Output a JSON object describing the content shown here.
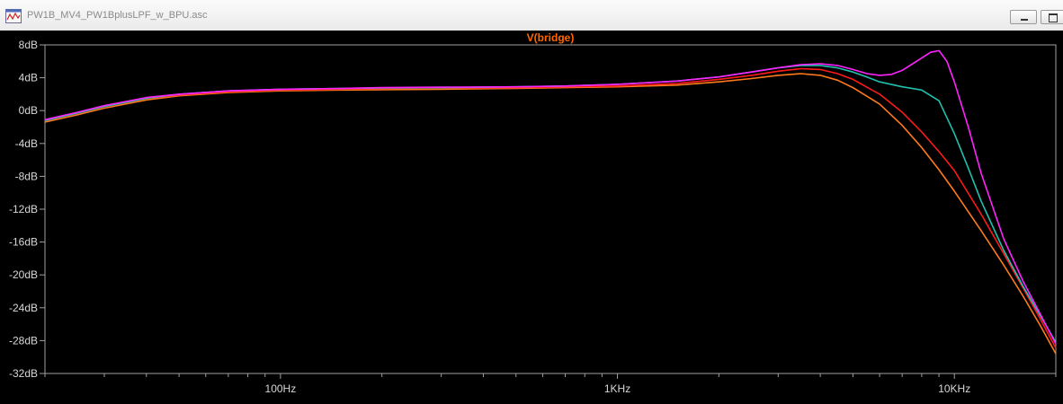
{
  "window": {
    "title": "PW1B_MV4_PW1BplusLPF_w_BPU.asc",
    "app_icon": "waveform-window-icon",
    "minimize_icon": "minimize-icon",
    "maximize_icon": "maximize-icon"
  },
  "colors": {
    "plot_background": "#000000",
    "axis": "#a0a0a0",
    "label_text": "#d8d8d8",
    "trace_label": "#ff6600"
  },
  "chart_data": {
    "type": "line",
    "title": "V(bridge)",
    "xlabel": "",
    "ylabel": "",
    "x_scale": "log",
    "xlim": [
      20,
      20000
    ],
    "ylim": [
      -32,
      8
    ],
    "grid": false,
    "x_ticks": [
      {
        "value": 100,
        "label": "100Hz"
      },
      {
        "value": 1000,
        "label": "1KHz"
      },
      {
        "value": 10000,
        "label": "10KHz"
      }
    ],
    "y_ticks": [
      {
        "value": 8,
        "label": "8dB"
      },
      {
        "value": 4,
        "label": "4dB"
      },
      {
        "value": 0,
        "label": "0dB"
      },
      {
        "value": -4,
        "label": "-4dB"
      },
      {
        "value": -8,
        "label": "-8dB"
      },
      {
        "value": -12,
        "label": "-12dB"
      },
      {
        "value": -16,
        "label": "-16dB"
      },
      {
        "value": -20,
        "label": "-20dB"
      },
      {
        "value": -24,
        "label": "-24dB"
      },
      {
        "value": -28,
        "label": "-28dB"
      },
      {
        "value": -32,
        "label": "-32dB"
      }
    ],
    "series": [
      {
        "color": "#ff7a1a",
        "points": [
          [
            20,
            -1.4
          ],
          [
            25,
            -0.5
          ],
          [
            30,
            0.3
          ],
          [
            40,
            1.3
          ],
          [
            50,
            1.8
          ],
          [
            70,
            2.2
          ],
          [
            100,
            2.4
          ],
          [
            150,
            2.5
          ],
          [
            200,
            2.55
          ],
          [
            300,
            2.6
          ],
          [
            500,
            2.7
          ],
          [
            700,
            2.8
          ],
          [
            1000,
            2.9
          ],
          [
            1500,
            3.1
          ],
          [
            2000,
            3.5
          ],
          [
            2500,
            3.9
          ],
          [
            3000,
            4.3
          ],
          [
            3500,
            4.5
          ],
          [
            4000,
            4.3
          ],
          [
            4500,
            3.7
          ],
          [
            5000,
            2.8
          ],
          [
            6000,
            0.8
          ],
          [
            7000,
            -1.8
          ],
          [
            8000,
            -4.5
          ],
          [
            9000,
            -7.2
          ],
          [
            10000,
            -9.8
          ],
          [
            12000,
            -14.6
          ],
          [
            14000,
            -18.8
          ],
          [
            16000,
            -22.6
          ],
          [
            18000,
            -26.2
          ],
          [
            20000,
            -29.6
          ]
        ]
      },
      {
        "color": "#ff1a1a",
        "points": [
          [
            20,
            -1.2
          ],
          [
            25,
            -0.3
          ],
          [
            30,
            0.5
          ],
          [
            40,
            1.5
          ],
          [
            50,
            1.9
          ],
          [
            70,
            2.3
          ],
          [
            100,
            2.5
          ],
          [
            150,
            2.6
          ],
          [
            200,
            2.7
          ],
          [
            300,
            2.75
          ],
          [
            500,
            2.8
          ],
          [
            700,
            2.9
          ],
          [
            1000,
            3.0
          ],
          [
            1500,
            3.3
          ],
          [
            2000,
            3.8
          ],
          [
            2500,
            4.3
          ],
          [
            3000,
            4.8
          ],
          [
            3500,
            5.1
          ],
          [
            4000,
            5.0
          ],
          [
            4500,
            4.5
          ],
          [
            5000,
            3.8
          ],
          [
            6000,
            2.0
          ],
          [
            7000,
            -0.2
          ],
          [
            8000,
            -2.6
          ],
          [
            9000,
            -5.0
          ],
          [
            10000,
            -7.3
          ],
          [
            12000,
            -12.6
          ],
          [
            14000,
            -17.4
          ],
          [
            16000,
            -21.6
          ],
          [
            18000,
            -25.4
          ],
          [
            20000,
            -28.9
          ]
        ]
      },
      {
        "color": "#20c0b0",
        "points": [
          [
            20,
            -1.2
          ],
          [
            25,
            -0.3
          ],
          [
            30,
            0.5
          ],
          [
            40,
            1.5
          ],
          [
            50,
            2.0
          ],
          [
            70,
            2.4
          ],
          [
            100,
            2.6
          ],
          [
            150,
            2.7
          ],
          [
            200,
            2.75
          ],
          [
            300,
            2.8
          ],
          [
            500,
            2.9
          ],
          [
            700,
            3.0
          ],
          [
            1000,
            3.2
          ],
          [
            1500,
            3.6
          ],
          [
            2000,
            4.1
          ],
          [
            2500,
            4.7
          ],
          [
            3000,
            5.2
          ],
          [
            3500,
            5.5
          ],
          [
            4000,
            5.5
          ],
          [
            4500,
            5.2
          ],
          [
            5000,
            4.7
          ],
          [
            5500,
            4.1
          ],
          [
            6000,
            3.5
          ],
          [
            7000,
            2.9
          ],
          [
            8000,
            2.5
          ],
          [
            9000,
            1.2
          ],
          [
            10000,
            -2.8
          ],
          [
            11000,
            -7.0
          ],
          [
            12000,
            -11.0
          ],
          [
            14000,
            -17.0
          ],
          [
            16000,
            -21.4
          ],
          [
            18000,
            -25.0
          ],
          [
            20000,
            -28.2
          ]
        ]
      },
      {
        "color": "#ff22ff",
        "points": [
          [
            20,
            -1.1
          ],
          [
            25,
            -0.2
          ],
          [
            30,
            0.6
          ],
          [
            40,
            1.6
          ],
          [
            50,
            2.0
          ],
          [
            70,
            2.4
          ],
          [
            100,
            2.6
          ],
          [
            150,
            2.7
          ],
          [
            200,
            2.8
          ],
          [
            300,
            2.85
          ],
          [
            500,
            2.9
          ],
          [
            700,
            3.0
          ],
          [
            1000,
            3.2
          ],
          [
            1500,
            3.6
          ],
          [
            2000,
            4.1
          ],
          [
            2500,
            4.7
          ],
          [
            3000,
            5.2
          ],
          [
            3500,
            5.6
          ],
          [
            4000,
            5.7
          ],
          [
            4500,
            5.5
          ],
          [
            5000,
            5.0
          ],
          [
            5500,
            4.5
          ],
          [
            6000,
            4.3
          ],
          [
            6500,
            4.4
          ],
          [
            7000,
            4.9
          ],
          [
            8000,
            6.4
          ],
          [
            8500,
            7.1
          ],
          [
            9000,
            7.3
          ],
          [
            9500,
            6.0
          ],
          [
            10000,
            3.5
          ],
          [
            11000,
            -2.0
          ],
          [
            12000,
            -7.6
          ],
          [
            14000,
            -15.6
          ],
          [
            16000,
            -20.8
          ],
          [
            18000,
            -24.8
          ],
          [
            20000,
            -28.4
          ]
        ]
      }
    ]
  }
}
